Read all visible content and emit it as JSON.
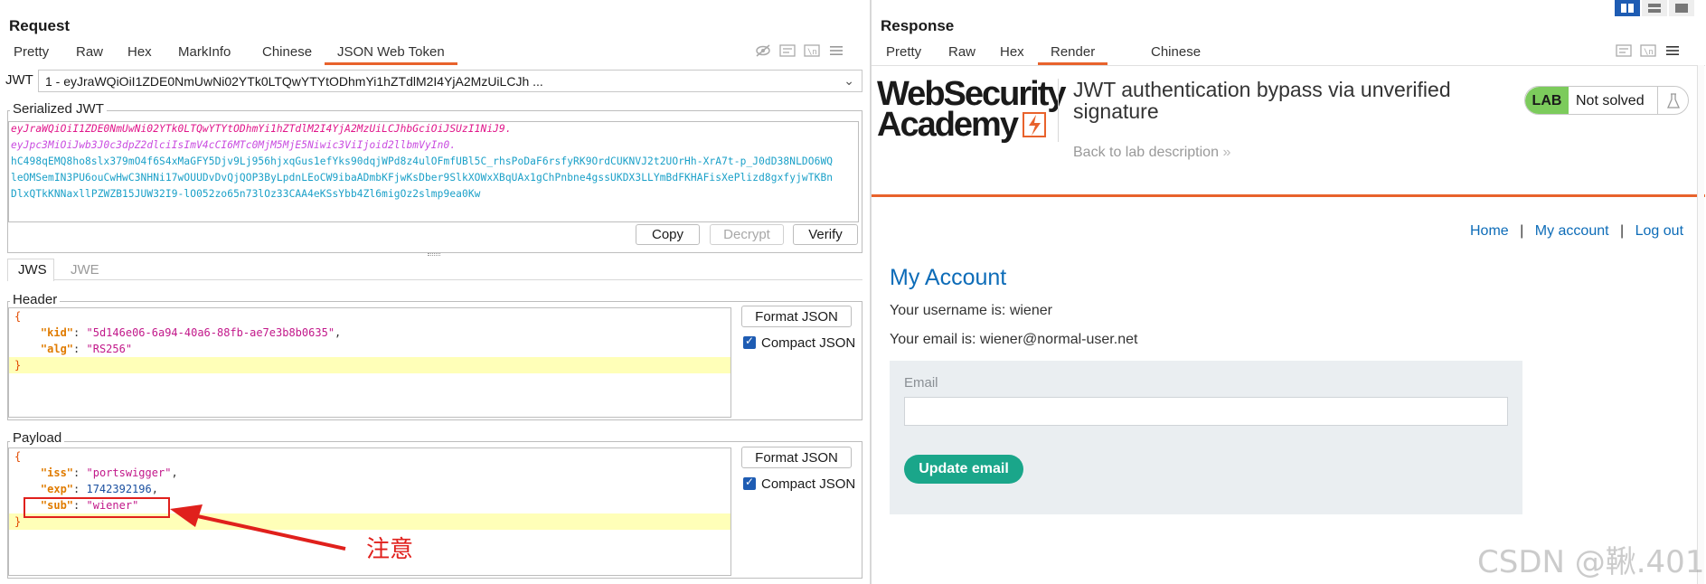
{
  "request": {
    "title": "Request",
    "tabs": [
      "Pretty",
      "Raw",
      "Hex",
      "MarkInfo",
      "Chinese",
      "JSON Web Token"
    ],
    "active_tab": "JSON Web Token",
    "jwt_label": "JWT",
    "jwt_select_value": "1 - eyJraWQiOiI1ZDE0NmUwNi02YTk0LTQwYTYtODhmYi1hZTdlM2I4YjA2MzUiLCJh ...",
    "serialized_legend": "Serialized JWT",
    "serialized_lines": [
      "eyJraWQiOiI1ZDE0NmUwNi02YTk0LTQwYTYtODhmYi1hZTdlM2I4YjA2MzUiLCJhbGciOiJSUzI1NiJ9.",
      "eyJpc3MiOiJwb3J0c3dpZ2dlciIsImV4cCI6MTc0MjM5MjE5Niwic3ViIjoid2llbmVyIn0.",
      "hC498qEMQ8ho8slx379mO4f6S4xMaGFY5Djv9Lj956hjxqGus1efYks90dqjWPd8z4ulOFmfUBl5C_rhsPoDaF6rsfyRK9OrdCUKNVJ2t2UOrHh-XrA7t-p_J0dD38NLDO6WQ",
      "leOMSemIN3PU6ouCwHwC3NHNi17wOUUDvDvQjQOP3ByLpdnLEoCW9ibaADmbKFjwKsDber9SlkXOWxXBqUAx1gChPnbne4gssUKDX3LLYmBdFKHAFisXePlizd8gxfyjwTKBn",
      "DlxQTkKNNaxllPZWZB15JUW32I9-lO052zo65n73lOz33CAA4eKSsYbb4Zl6migOz2slmp9ea0Kw"
    ],
    "buttons": {
      "copy": "Copy",
      "decrypt": "Decrypt",
      "verify": "Verify"
    },
    "sub_tabs": [
      "JWS",
      "JWE"
    ],
    "header_legend": "Header",
    "header_json": {
      "kid": "5d146e06-6a94-40a6-88fb-ae7e3b8b0635",
      "alg": "RS256"
    },
    "payload_legend": "Payload",
    "payload_json": {
      "iss": "portswigger",
      "exp": "1742392196",
      "sub": "wiener"
    },
    "format_json": "Format JSON",
    "compact_json": "Compact JSON",
    "annotation": "注意"
  },
  "response": {
    "title": "Response",
    "tabs": [
      "Pretty",
      "Raw",
      "Hex",
      "Render",
      "Chinese"
    ],
    "active_tab": "Render",
    "logo_line1": "WebSecurity",
    "logo_line2": "Academy",
    "lab_title": "JWT authentication bypass via unverified signature",
    "back_link": "Back to lab description",
    "lab_badge": "LAB",
    "lab_status": "Not solved",
    "nav": [
      "Home",
      "My account",
      "Log out"
    ],
    "heading": "My Account",
    "username_line": "Your username is: wiener",
    "email_line": "Your email is: wiener@normal-user.net",
    "email_label": "Email",
    "email_placeholder": "",
    "update_button": "Update email"
  },
  "watermark": "CSDN @鞦.401",
  "colors": {
    "accent": "#e8622c",
    "lab_green": "#7ccb5c",
    "link_blue": "#0d6cb8",
    "update_green": "#1aa68a"
  }
}
